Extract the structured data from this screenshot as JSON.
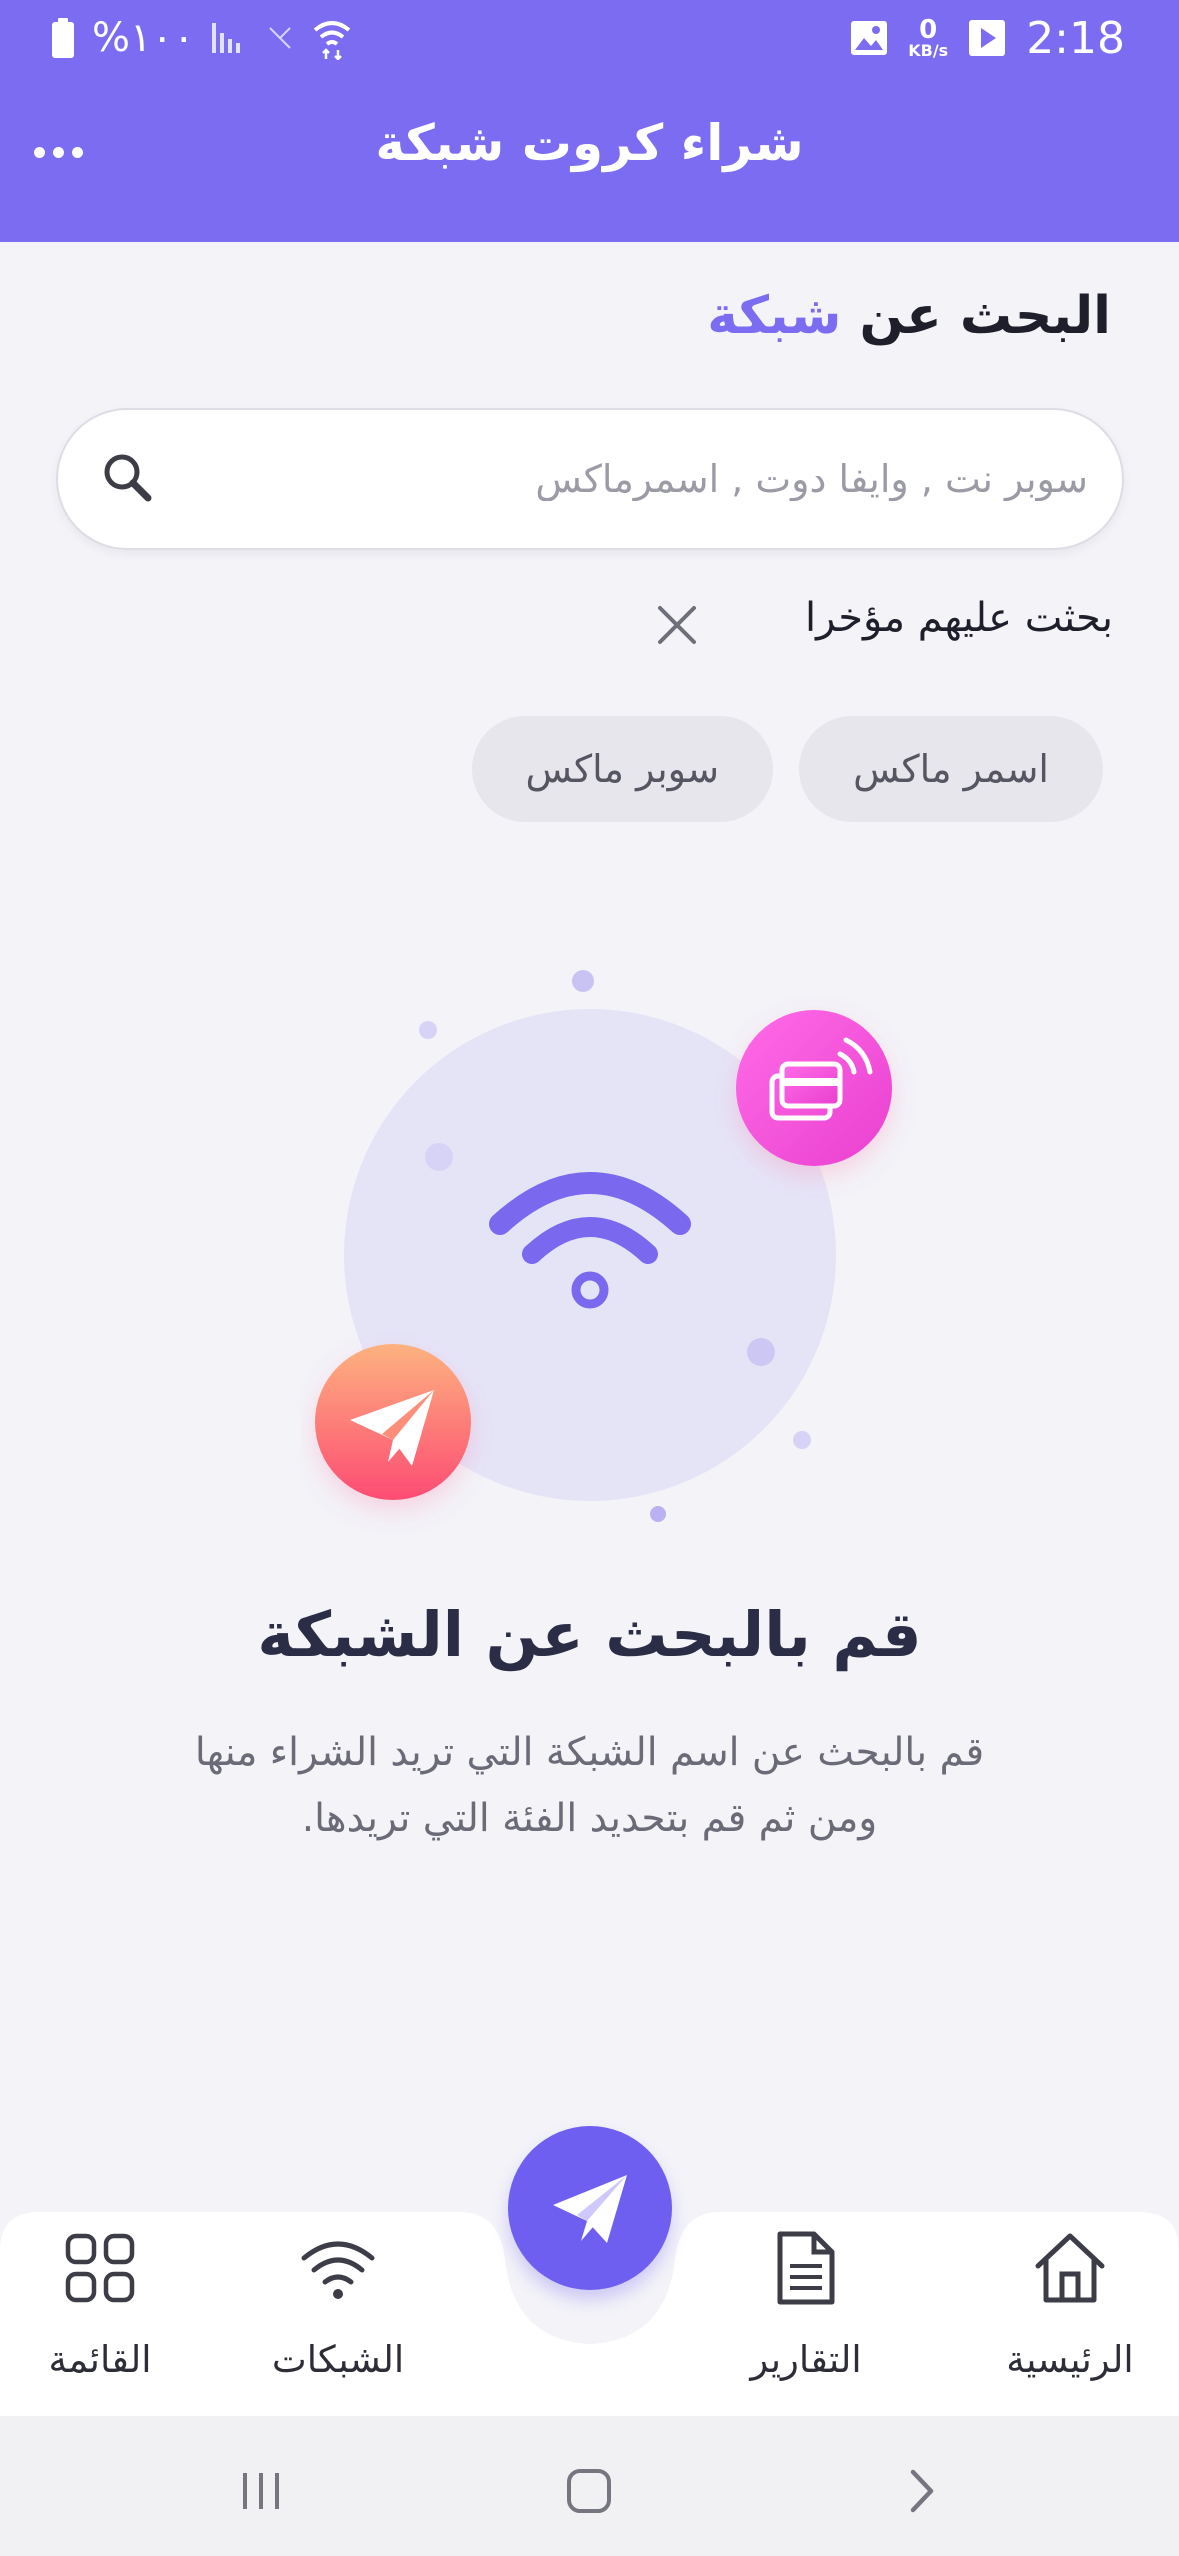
{
  "status_bar": {
    "battery_text": "%١٠٠",
    "time": "2:18",
    "data_speed_value": "0",
    "data_speed_unit": "KB/s"
  },
  "app_bar": {
    "title": "شراء كروت شبكة"
  },
  "search": {
    "heading_prefix": "البحث عن",
    "heading_accent": "شبكة",
    "placeholder": "سوبر نت , وايفا دوت , اسمرماكس",
    "value": ""
  },
  "recent": {
    "label": "بحثت عليهم مؤخرا",
    "items": [
      "اسمر ماكس",
      "سوبر ماكس"
    ]
  },
  "empty_state": {
    "title": "قم بالبحث عن الشبكة",
    "description": "قم بالبحث عن اسم الشبكة التي تريد الشراء منها ومن ثم قم بتحديد الفئة التي تريدها."
  },
  "bottom_nav": {
    "home": "الرئيسية",
    "reports": "التقارير",
    "networks": "الشبكات",
    "menu": "القائمة"
  },
  "colors": {
    "primary": "#7b6cf1",
    "fab": "#6e5ff0",
    "pink_badge": "#f04ad6",
    "orange_badge": "#fb6a76"
  }
}
